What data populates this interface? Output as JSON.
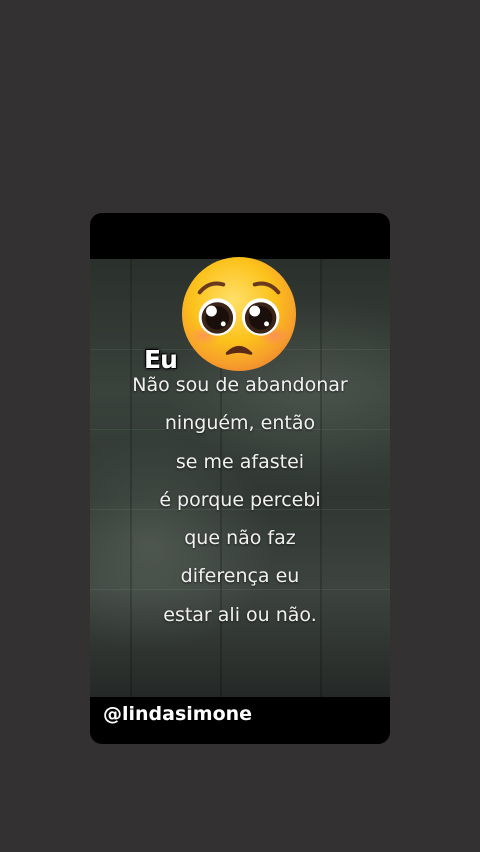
{
  "card": {
    "label": "Eu",
    "quote_lines": [
      "Não sou de abandonar",
      "ninguém, então",
      "se me afastei",
      "é porque percebi",
      "que não faz",
      "diferença eu",
      "estar ali ou não."
    ],
    "handle": "@lindasimone",
    "emoji_icon": "pleading-face-icon"
  },
  "colors": {
    "page_background": "#333132",
    "card_bar": "#000000",
    "emoji_yellow": "#fcc21b"
  }
}
